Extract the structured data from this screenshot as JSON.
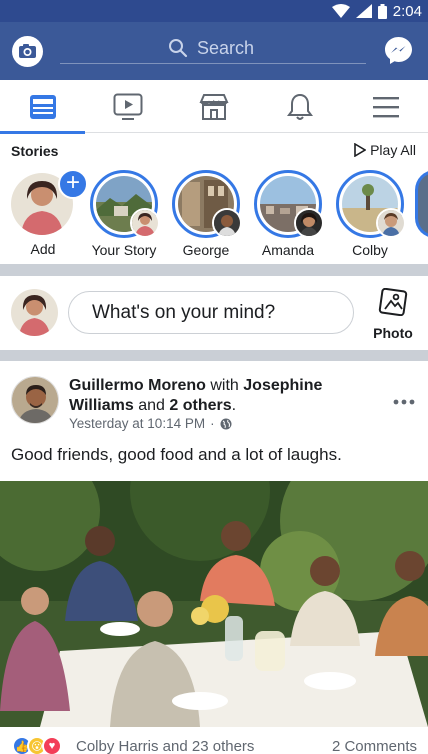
{
  "status_bar": {
    "time": "2:04"
  },
  "header": {
    "search_placeholder": "Search"
  },
  "nav": {
    "tabs": [
      {
        "icon": "news-feed-icon",
        "active": true
      },
      {
        "icon": "video-icon",
        "active": false
      },
      {
        "icon": "marketplace-icon",
        "active": false
      },
      {
        "icon": "bell-icon",
        "active": false
      },
      {
        "icon": "menu-icon",
        "active": false
      }
    ]
  },
  "stories": {
    "title": "Stories",
    "play_all": "Play All",
    "items": [
      {
        "name": "Add"
      },
      {
        "name": "Your Story"
      },
      {
        "name": "George"
      },
      {
        "name": "Amanda"
      },
      {
        "name": "Colby"
      }
    ]
  },
  "composer": {
    "placeholder": "What's on your mind?",
    "photo_label": "Photo"
  },
  "post": {
    "author": "Guillermo Moreno",
    "with_word": "with",
    "tagged": "Josephine Williams",
    "and_word": "and",
    "others": "2 others",
    "period": ".",
    "timestamp": "Yesterday at 10:14 PM",
    "separator": "·",
    "text": "Good friends, good food and a lot of laughs.",
    "reactions_text": "Colby Harris and 23 others",
    "comments_text": "2 Comments"
  },
  "colors": {
    "brand": "#3b5998",
    "status_bar": "#2e4a8f",
    "accent": "#3578e5"
  }
}
